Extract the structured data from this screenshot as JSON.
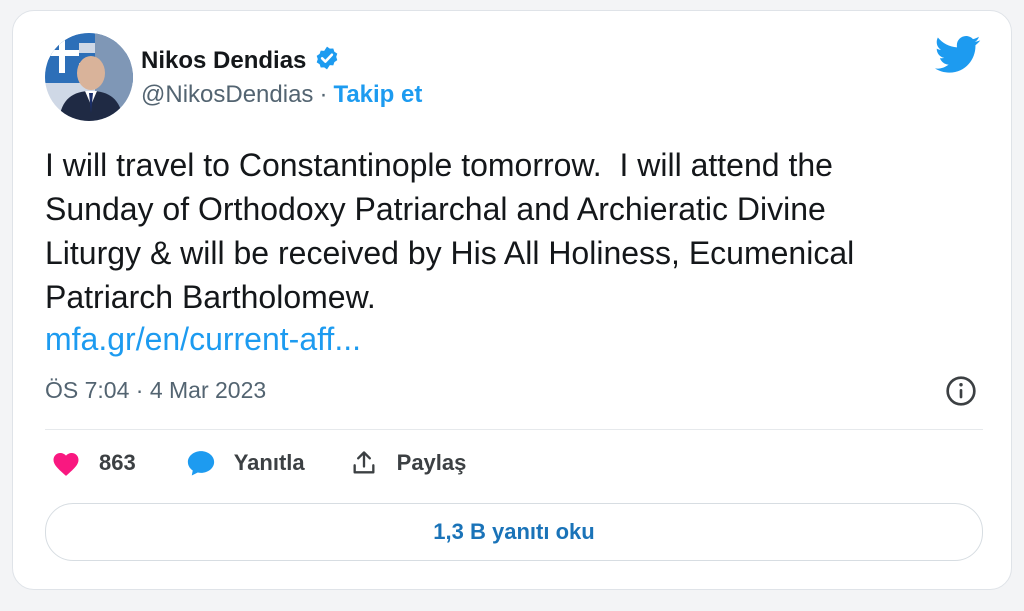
{
  "tweet": {
    "author_name": "Nikos Dendias",
    "handle": "@NikosDendias",
    "separator": "·",
    "follow_label": "Takip et",
    "text": "I will travel to Constantinople tomorrow.  I will attend the\nSunday of Orthodoxy Patriarchal and Archieratic Divine\nLiturgy & will be received by His All Holiness, Ecumenical\nPatriarch Bartholomew.",
    "link_text": "mfa.gr/en/current-aff...",
    "timestamp": "ÖS 7:04 · 4 Mar 2023"
  },
  "actions": {
    "like_count": "863",
    "reply_label": "Yanıtla",
    "share_label": "Paylaş"
  },
  "read_replies_label": "1,3 B yanıtı oku",
  "icons": {
    "verified": "verified-badge-icon",
    "twitter": "twitter-bird-icon",
    "info": "info-icon",
    "like": "heart-icon",
    "reply": "speech-bubble-icon",
    "share": "share-upload-icon"
  },
  "colors": {
    "accent": "#1d9bf0",
    "like": "#f91880",
    "text": "#14171a",
    "secondary": "#536471"
  }
}
